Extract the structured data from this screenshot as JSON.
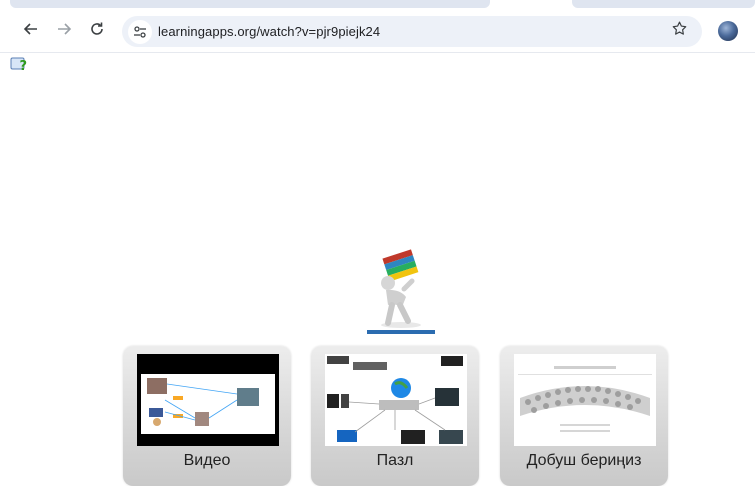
{
  "browser": {
    "url": "learningapps.org/watch?v=pjr9piejk24",
    "back_icon": "arrow-left-icon",
    "forward_icon": "arrow-right-icon",
    "reload_icon": "reload-icon",
    "bookmark_icon": "star-icon"
  },
  "page": {
    "help_icon": "help-question-icon",
    "hero_image": "man-carrying-books-image"
  },
  "cards": [
    {
      "label": "Видео",
      "thumbnail": "video-thumbnail-network-diagram"
    },
    {
      "label": "Пазл",
      "thumbnail": "puzzle-thumbnail-network-devices"
    },
    {
      "label": "Добуш бериңиз",
      "thumbnail": "vote-thumbnail-audience"
    }
  ],
  "colors": {
    "omnibox": "#edf1f8",
    "card_top": "#ededed",
    "card_bottom": "#c9c9c9"
  }
}
